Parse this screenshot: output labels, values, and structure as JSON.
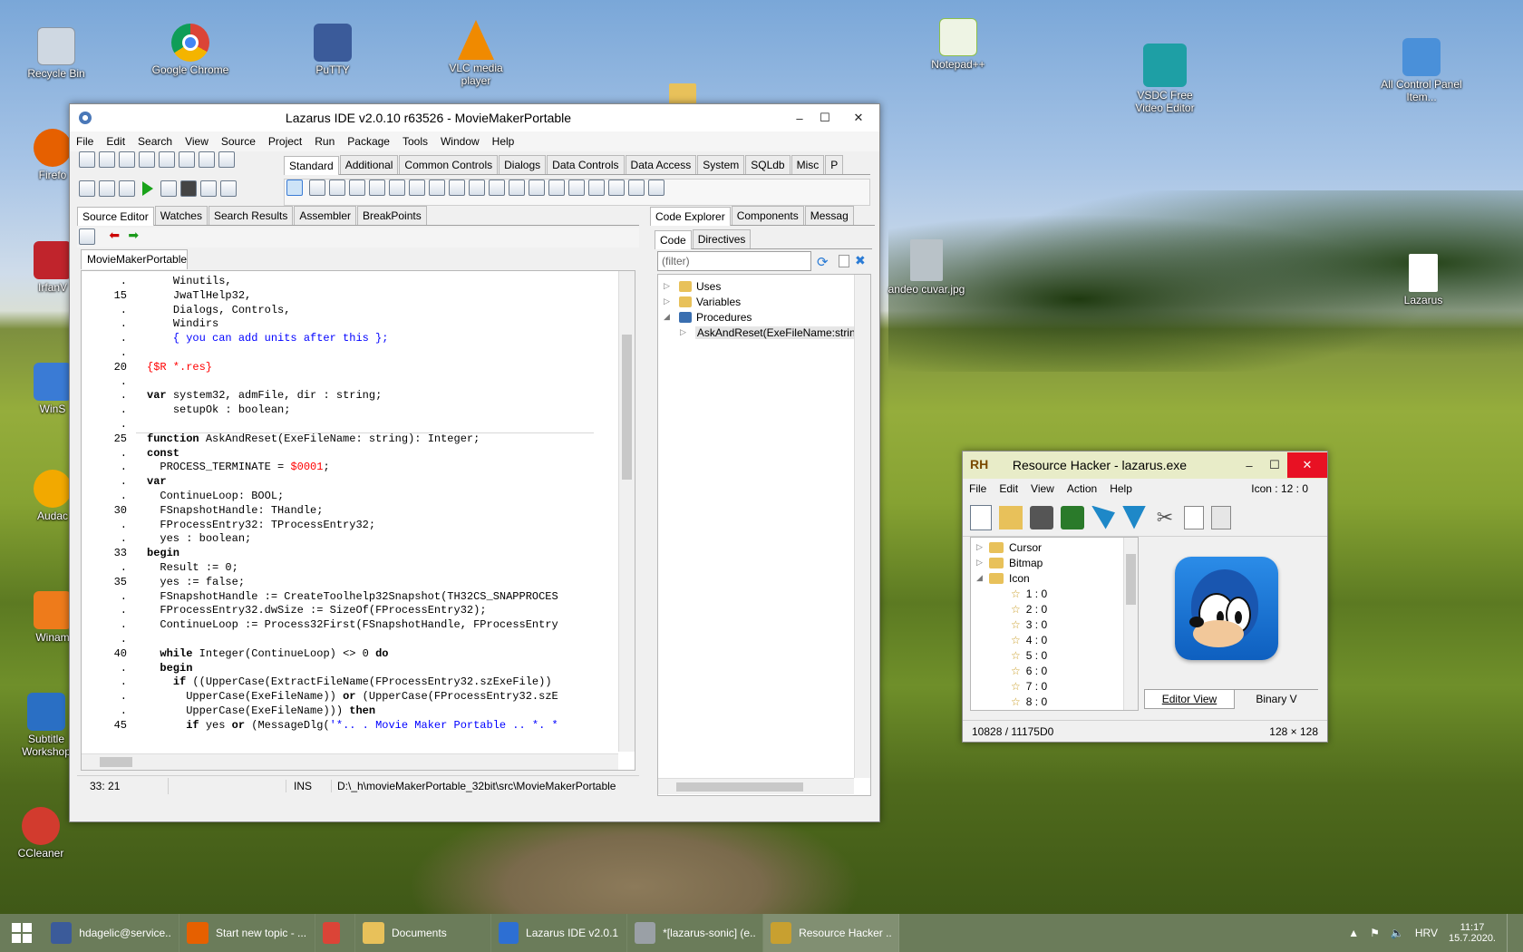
{
  "desktop": {
    "icons": [
      {
        "name": "recycle-bin",
        "label": "Recycle Bin",
        "color": "#cfd8e2"
      },
      {
        "name": "google-chrome",
        "label": "Google Chrome",
        "color": "#db4437"
      },
      {
        "name": "putty",
        "label": "PuTTY",
        "color": "#3b5b9a"
      },
      {
        "name": "vlc",
        "label": "VLC media player",
        "color": "#f08a00"
      },
      {
        "name": "notepadpp",
        "label": "Notepad++",
        "color": "#8cc04a"
      },
      {
        "name": "vsdc",
        "label": "VSDC Free Video Editor",
        "color": "#1e9fa5"
      },
      {
        "name": "control-panel",
        "label": "All Control Panel Item...",
        "color": "#4a90d9"
      },
      {
        "name": "firefox",
        "label": "Firefo",
        "color": "#e66000"
      },
      {
        "name": "irfanview",
        "label": "IrfanV",
        "color": "#c0242c"
      },
      {
        "name": "winscp",
        "label": "WinS",
        "color": "#3a7bd5"
      },
      {
        "name": "audacity",
        "label": "Audac",
        "color": "#f2a900"
      },
      {
        "name": "winamp",
        "label": "Winam",
        "color": "#ee7b1b"
      },
      {
        "name": "subtitle-workshop",
        "label": "Subtitle Workshop",
        "color": "#2a6fc4"
      },
      {
        "name": "ccleaner",
        "label": "CCleaner",
        "color": "#d23b2e"
      },
      {
        "name": "andeo-cuvar",
        "label": "andeo cuvar.jpg",
        "color": "#b9c2c8"
      },
      {
        "name": "lazarus-file",
        "label": "Lazarus",
        "color": "#ffffff"
      }
    ]
  },
  "lazarus": {
    "title": "Lazarus IDE v2.0.10 r63526 - MovieMakerPortable",
    "menu": [
      "File",
      "Edit",
      "Search",
      "View",
      "Source",
      "Project",
      "Run",
      "Package",
      "Tools",
      "Window",
      "Help"
    ],
    "palette_tabs": [
      "Standard",
      "Additional",
      "Common Controls",
      "Dialogs",
      "Data Controls",
      "Data Access",
      "System",
      "SQLdb",
      "Misc",
      "P"
    ],
    "editor_tabs": [
      "Source Editor",
      "Watches",
      "Search Results",
      "Assembler",
      "BreakPoints"
    ],
    "file_tab": "MovieMakerPortable",
    "code_lines": [
      {
        "n": ".",
        "t": "    Winutils,",
        "c": "p"
      },
      {
        "n": "15",
        "t": "    JwaTlHelp32,",
        "c": "p"
      },
      {
        "n": ".",
        "t": "    Dialogs, Controls,",
        "c": "p"
      },
      {
        "n": ".",
        "t": "    Windirs",
        "c": "p"
      },
      {
        "n": ".",
        "t": "    { you can add units after this };",
        "c": "cm"
      },
      {
        "n": ".",
        "t": "",
        "c": "p"
      },
      {
        "n": "20",
        "t": "{$R *.res}",
        "c": "dir"
      },
      {
        "n": ".",
        "t": "",
        "c": "p"
      },
      {
        "n": ".",
        "t": "var system32, admFile, dir : string;",
        "c": "p"
      },
      {
        "n": ".",
        "t": "    setupOk : boolean;",
        "c": "p"
      },
      {
        "n": ".",
        "t": "",
        "c": "p"
      },
      {
        "n": "25",
        "t": "function AskAndReset(ExeFileName: string): Integer;",
        "c": "p"
      },
      {
        "n": ".",
        "t": "const",
        "c": "p"
      },
      {
        "n": ".",
        "t": "  PROCESS_TERMINATE = $0001;",
        "c": "p"
      },
      {
        "n": ".",
        "t": "var",
        "c": "p"
      },
      {
        "n": ".",
        "t": "  ContinueLoop: BOOL;",
        "c": "p"
      },
      {
        "n": "30",
        "t": "  FSnapshotHandle: THandle;",
        "c": "p"
      },
      {
        "n": ".",
        "t": "  FProcessEntry32: TProcessEntry32;",
        "c": "p"
      },
      {
        "n": ".",
        "t": "  yes : boolean;",
        "c": "p"
      },
      {
        "n": "33",
        "t": "begin",
        "c": "p"
      },
      {
        "n": ".",
        "t": "  Result := 0;",
        "c": "p"
      },
      {
        "n": "35",
        "t": "  yes := false;",
        "c": "p"
      },
      {
        "n": ".",
        "t": "  FSnapshotHandle := CreateToolhelp32Snapshot(TH32CS_SNAPPROCES",
        "c": "p"
      },
      {
        "n": ".",
        "t": "  FProcessEntry32.dwSize := SizeOf(FProcessEntry32);",
        "c": "p"
      },
      {
        "n": ".",
        "t": "  ContinueLoop := Process32First(FSnapshotHandle, FProcessEntry",
        "c": "p"
      },
      {
        "n": ".",
        "t": "",
        "c": "p"
      },
      {
        "n": "40",
        "t": "  while Integer(ContinueLoop) <> 0 do",
        "c": "p"
      },
      {
        "n": ".",
        "t": "  begin",
        "c": "p"
      },
      {
        "n": ".",
        "t": "    if ((UpperCase(ExtractFileName(FProcessEntry32.szExeFile))",
        "c": "p"
      },
      {
        "n": ".",
        "t": "      UpperCase(ExeFileName)) or (UpperCase(FProcessEntry32.szE",
        "c": "p"
      },
      {
        "n": ".",
        "t": "      UpperCase(ExeFileName))) then",
        "c": "p"
      },
      {
        "n": "45",
        "t": "      if yes or (MessageDlg('*.. . Movie Maker Portable .. *. *",
        "c": "p"
      }
    ],
    "status": {
      "pos": "33: 21",
      "mode": "INS",
      "path": "D:\\_h\\movieMakerPortable_32bit\\src\\MovieMakerPortable"
    },
    "right_tabs": [
      "Code Explorer",
      "Components",
      "Messag"
    ],
    "sub_tabs": [
      "Code",
      "Directives"
    ],
    "filter_placeholder": "(filter)",
    "tree": [
      "Uses",
      "Variables",
      "Procedures",
      "AskAndReset(ExeFileName:strin"
    ]
  },
  "reshacker": {
    "title": "Resource Hacker - lazarus.exe",
    "menu": [
      "File",
      "Edit",
      "View",
      "Action",
      "Help"
    ],
    "icon_info": "Icon : 12 : 0",
    "tree": [
      "Cursor",
      "Bitmap",
      "Icon",
      "1 : 0",
      "2 : 0",
      "3 : 0",
      "4 : 0",
      "5 : 0",
      "6 : 0",
      "7 : 0",
      "8 : 0"
    ],
    "view_tabs": [
      "Editor View",
      "Binary V"
    ],
    "status_left": "10828 / 11175D0",
    "status_right": "128 × 128"
  },
  "taskbar": {
    "items": [
      {
        "label": "hdagelic@service...",
        "color": "#3b5b9a"
      },
      {
        "label": "Start new topic - ...",
        "color": "#e66000"
      },
      {
        "label": "",
        "color": "#db4437"
      },
      {
        "label": "Documents",
        "color": "#e8c15a"
      },
      {
        "label": "Lazarus IDE v2.0.1...",
        "color": "#2d6fd3"
      },
      {
        "label": "*[lazarus-sonic] (e...",
        "color": "#9aa0a6"
      },
      {
        "label": "Resource Hacker ...",
        "color": "#c8a030"
      }
    ],
    "lang": "HRV",
    "time": "11:17",
    "date": "15.7.2020."
  }
}
